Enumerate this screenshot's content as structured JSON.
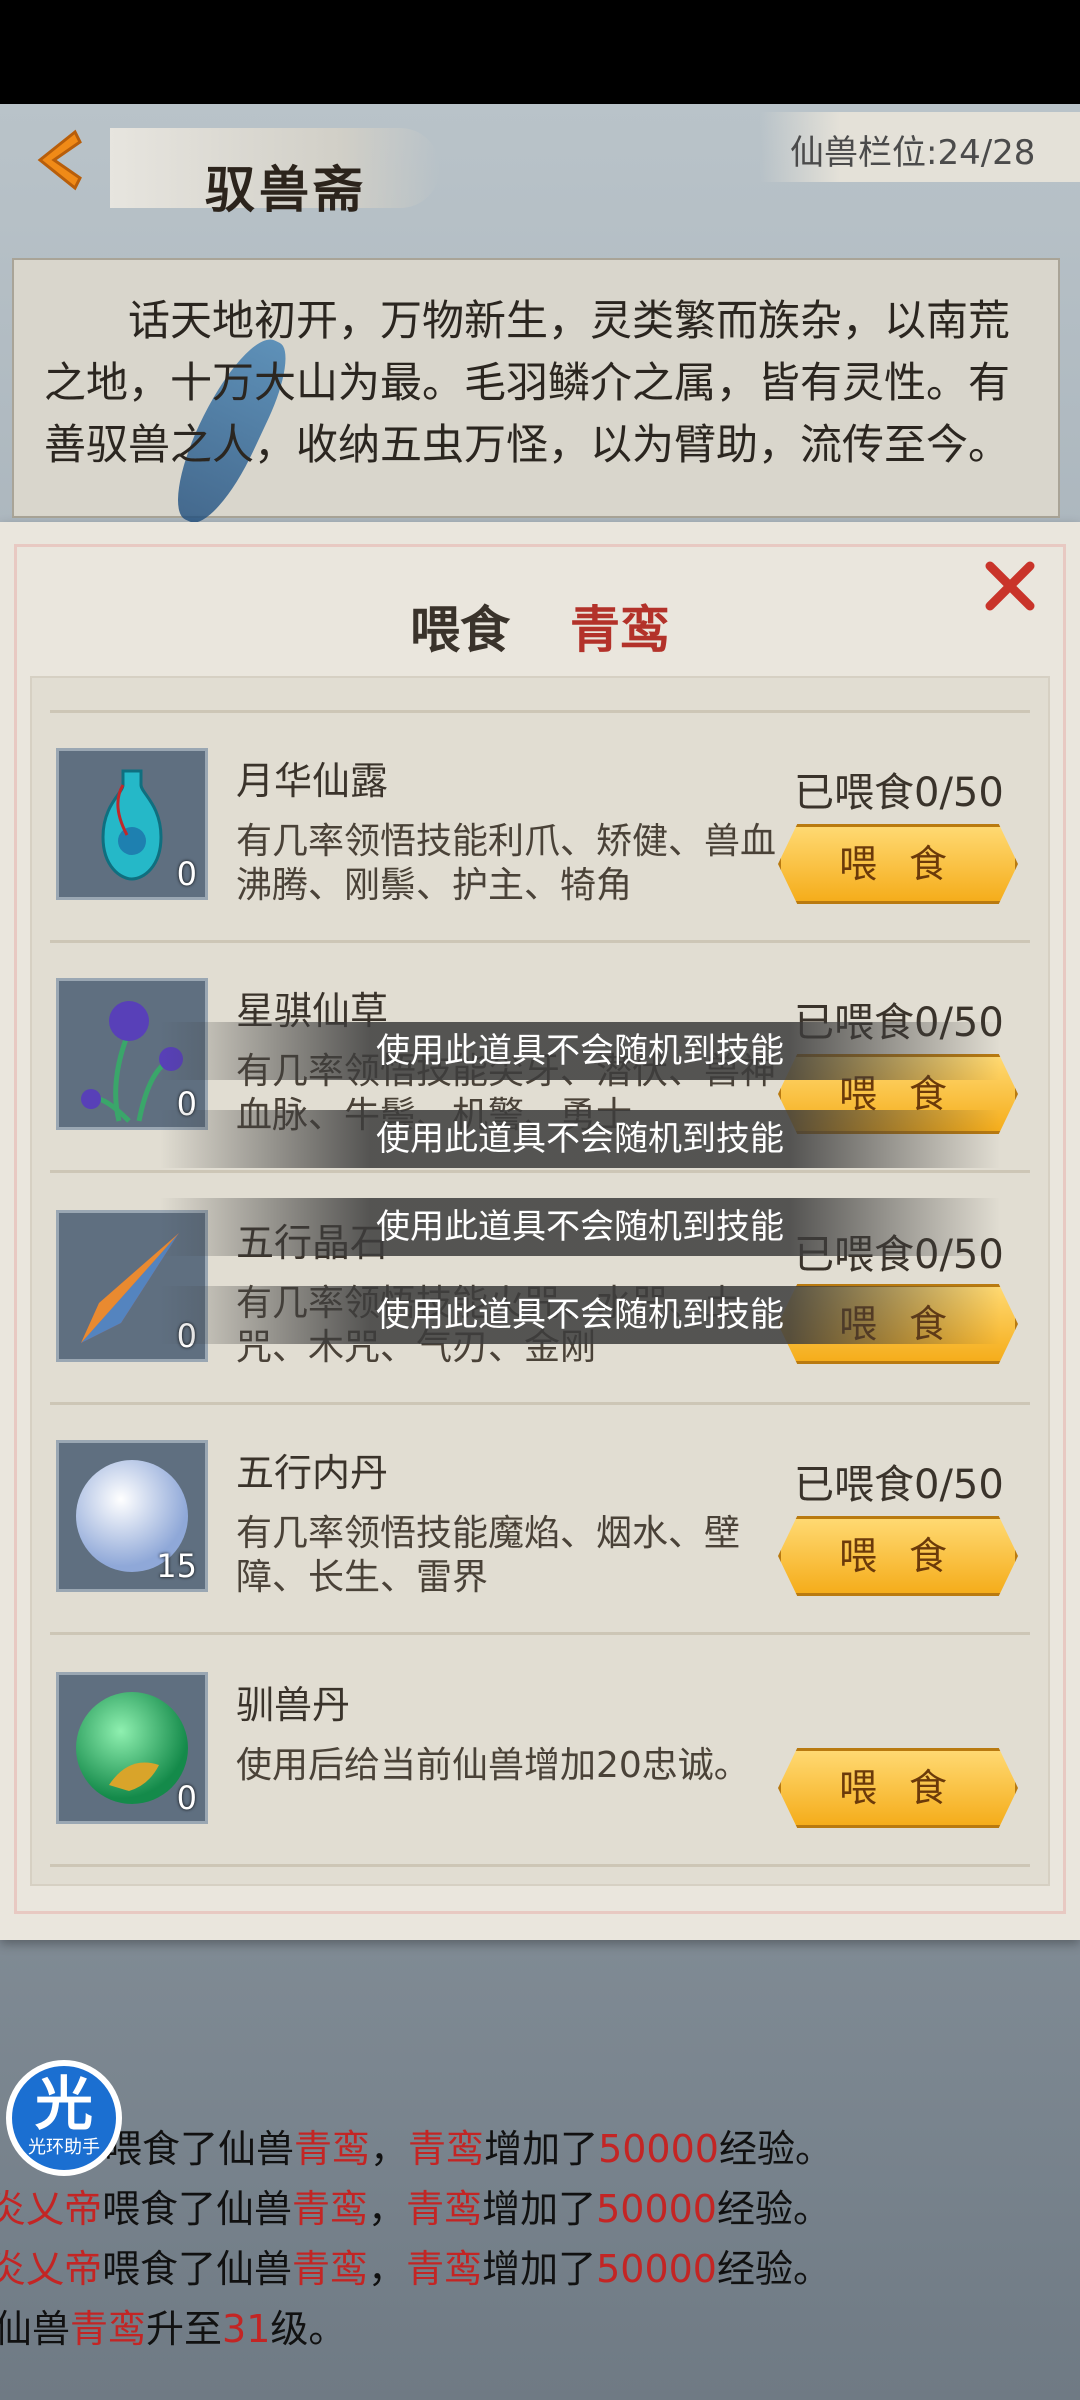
{
  "header": {
    "title": "驭兽斋",
    "slots": "仙兽栏位:24/28"
  },
  "story": "话天地初开，万物新生，灵类繁而族杂，以南荒之地，十万大山为最。毛羽鳞介之属，皆有灵性。有善驭兽之人，收纳五虫万怪，以为臂助，流传至今。",
  "modal": {
    "feed_label": "喂食",
    "pet_name": "青鸾"
  },
  "feed_button_label": "喂 食",
  "items": [
    {
      "name": "月华仙露",
      "fed": "已喂食0/50",
      "count": "0",
      "desc": "有几率领悟技能利爪、矫健、兽血沸腾、刚鬃、护主、犄角",
      "icon": "vase-icon"
    },
    {
      "name": "星骐仙草",
      "fed": "已喂食0/50",
      "count": "0",
      "desc": "有几率领悟技能尖牙、潜伏、兽神血脉、牛鬃、机警、勇士",
      "icon": "herb-icon"
    },
    {
      "name": "五行晶石",
      "fed": "已喂食0/50",
      "count": "0",
      "desc": "有几率领悟技能火咒、水咒、土咒、木咒、气刃、金刚",
      "icon": "crystal-icon"
    },
    {
      "name": "五行内丹",
      "fed": "已喂食0/50",
      "count": "15",
      "desc": "有几率领悟技能魔焰、烟水、壁障、长生、雷界",
      "icon": "orb-icon"
    },
    {
      "name": "驯兽丹",
      "fed": "",
      "count": "0",
      "desc": "使用后给当前仙兽增加20忠诚。",
      "icon": "pill-icon"
    }
  ],
  "toasts": [
    "使用此道具不会随机到技能",
    "使用此道具不会随机到技能",
    "使用此道具不会随机到技能",
    "使用此道具不会随机到技能"
  ],
  "log": [
    {
      "a": "喂食了仙兽",
      "pet": "青鸾",
      "b": "，",
      "pet2": "青鸾",
      "c": "增加了",
      "num": "50000",
      "d": "经验。",
      "who": ""
    },
    {
      "who": "炎乂帝",
      "a": "喂食了仙兽",
      "pet": "青鸾",
      "b": "，",
      "pet2": "青鸾",
      "c": "增加了",
      "num": "50000",
      "d": "经验。"
    },
    {
      "who": "炎乂帝",
      "a": "喂食了仙兽",
      "pet": "青鸾",
      "b": "，",
      "pet2": "青鸾",
      "c": "增加了",
      "num": "50000",
      "d": "经验。"
    }
  ],
  "log_level": {
    "a": "仙兽",
    "pet": "青鸾",
    "b": "升至",
    "lvl": "31",
    "c": "级。"
  },
  "assistant": {
    "char": "光",
    "label": "光环助手"
  },
  "colors": {
    "accent_red": "#c32524",
    "button_gold": "#f5ad1b"
  }
}
